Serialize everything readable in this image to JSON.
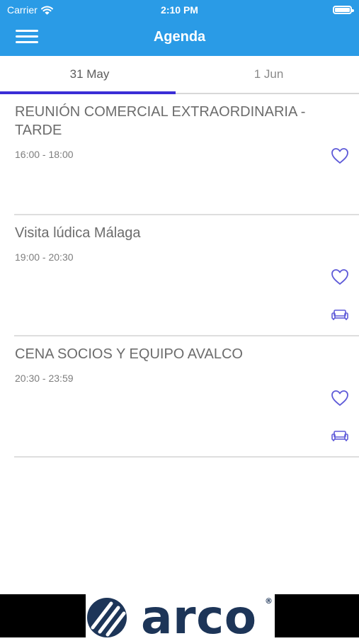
{
  "status_bar": {
    "carrier": "Carrier",
    "time": "2:10 PM"
  },
  "header": {
    "title": "Agenda"
  },
  "tabs": [
    {
      "label": "31 May",
      "selected": true
    },
    {
      "label": "1 Jun",
      "selected": false
    }
  ],
  "events": [
    {
      "title": "REUNIÓN COMERCIAL EXTRAORDINARIA - TARDE",
      "time": "16:00 - 18:00"
    },
    {
      "title": "Visita lúdica Málaga",
      "time": "19:00 - 20:30"
    },
    {
      "title": "CENA SOCIOS Y EQUIPO AVALCO",
      "time": "20:30 - 23:59"
    }
  ],
  "footer": {
    "logo_text": "arco",
    "registered_mark": "®"
  },
  "colors": {
    "header": "#2a9be6",
    "accent": "#3a2ed6",
    "icon": "#5e5ad8"
  }
}
